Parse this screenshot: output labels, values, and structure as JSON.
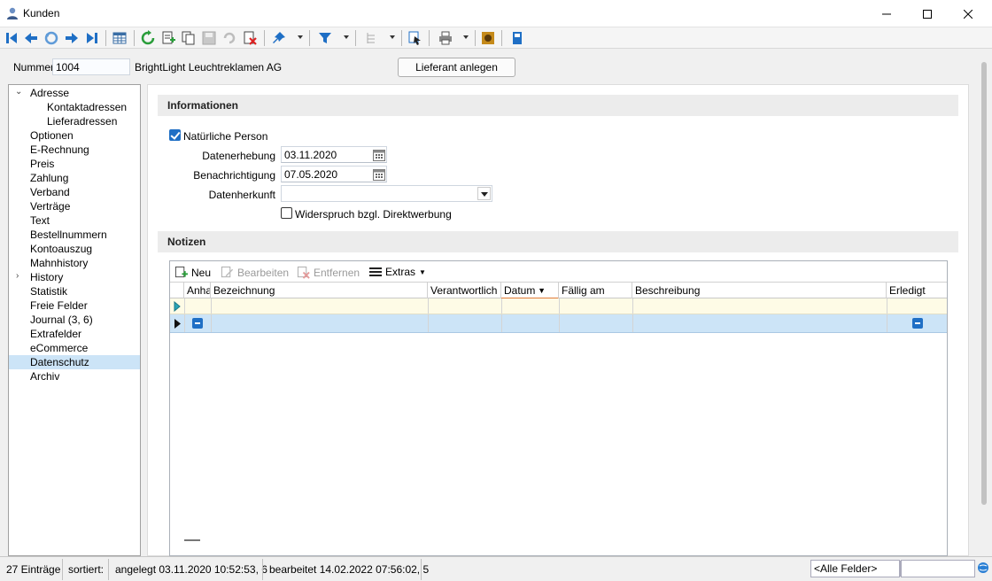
{
  "window": {
    "title": "Kunden"
  },
  "header": {
    "nummer_label": "Nummer",
    "nummer_value": "1004",
    "customer_name": "BrightLight Leuchtreklamen AG",
    "lieferant_button": "Lieferant anlegen"
  },
  "tree": {
    "items": [
      {
        "label": "Adresse"
      },
      {
        "label": "Kontaktadressen"
      },
      {
        "label": "Lieferadressen"
      },
      {
        "label": "Optionen"
      },
      {
        "label": "E-Rechnung"
      },
      {
        "label": "Preis"
      },
      {
        "label": "Zahlung"
      },
      {
        "label": "Verband"
      },
      {
        "label": "Verträge"
      },
      {
        "label": "Text"
      },
      {
        "label": "Bestellnummern"
      },
      {
        "label": "Kontoauszug"
      },
      {
        "label": "Mahnhistory"
      },
      {
        "label": "History"
      },
      {
        "label": "Statistik"
      },
      {
        "label": "Freie Felder"
      },
      {
        "label": "Journal (3, 6)"
      },
      {
        "label": "Extrafelder"
      },
      {
        "label": "eCommerce"
      },
      {
        "label": "Datenschutz"
      },
      {
        "label": "Archiv"
      }
    ],
    "selected": "Datenschutz"
  },
  "informationen": {
    "title": "Informationen",
    "natuerliche_person_label": "Natürliche Person",
    "natuerliche_person_checked": true,
    "datenerhebung_label": "Datenerhebung",
    "datenerhebung_value": "03.11.2020",
    "benachrichtigung_label": "Benachrichtigung",
    "benachrichtigung_value": "07.05.2020",
    "datenherkunft_label": "Datenherkunft",
    "datenherkunft_value": "",
    "widerspruch_label": "Widerspruch bzgl. Direktwerbung",
    "widerspruch_checked": false
  },
  "notizen": {
    "title": "Notizen",
    "tools": {
      "neu": "Neu",
      "bearbeiten": "Bearbeiten",
      "entfernen": "Entfernen",
      "extras": "Extras"
    },
    "columns": [
      "Anha",
      "Bezeichnung",
      "Verantwortlich",
      "Datum",
      "Fällig am",
      "Beschreibung",
      "Erledigt"
    ]
  },
  "statusbar": {
    "entries": "27 Einträge",
    "sorted": "sortiert:",
    "angelegt": "angelegt 03.11.2020 10:52:53,  6",
    "bearbeitet": "bearbeitet 14.02.2022 07:56:02,  5",
    "filter": "<Alle Felder>"
  },
  "colors": {
    "accent": "#1f6fc5",
    "selection": "#cce4f7"
  }
}
